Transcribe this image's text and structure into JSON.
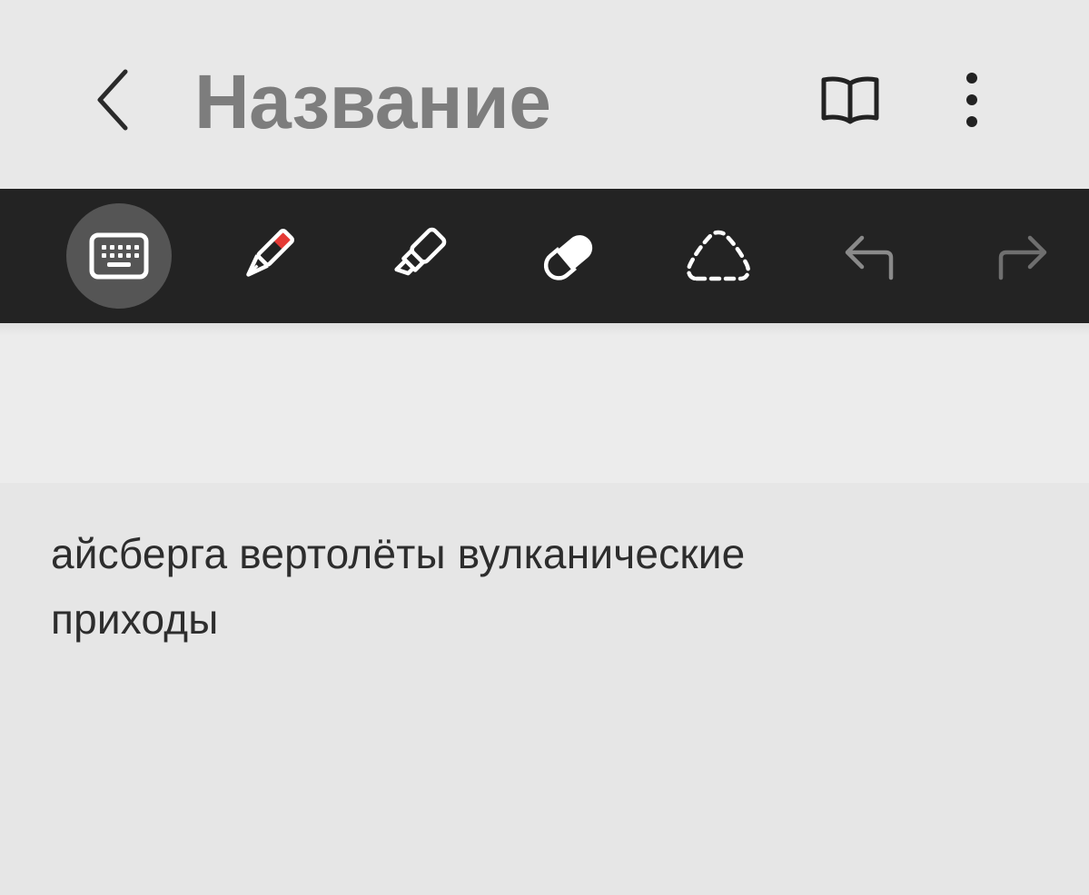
{
  "header": {
    "title": "Название"
  },
  "icons": {
    "back": "chevron-left-icon",
    "reading_mode": "open-book-icon",
    "more": "more-vertical-icon"
  },
  "toolbar": {
    "tools": [
      "keyboard-icon",
      "pen-icon",
      "highlighter-icon",
      "eraser-icon",
      "lasso-icon",
      "undo-icon",
      "redo-icon"
    ],
    "active_tool": "keyboard",
    "pen_color": "#e53935"
  },
  "note": {
    "line1": "айсберга вертолёты вулканические",
    "line2": "приходы"
  }
}
